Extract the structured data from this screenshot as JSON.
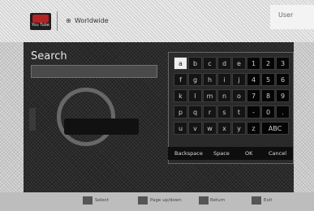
{
  "app": {
    "logo_text": "You Tube",
    "breadcrumb": "Worldwide",
    "breadcrumb_icon": "globe-icon",
    "top_right": "User"
  },
  "search": {
    "title": "Search"
  },
  "keyboard": {
    "rows": [
      [
        "a",
        "b",
        "c",
        "d",
        "e",
        "1",
        "2",
        "3"
      ],
      [
        "f",
        "g",
        "h",
        "i",
        "j",
        "4",
        "5",
        "6"
      ],
      [
        "k",
        "l",
        "m",
        "n",
        "o",
        "7",
        "8",
        "9"
      ],
      [
        "p",
        "q",
        "r",
        "s",
        "t",
        "-",
        "0",
        "."
      ],
      [
        "u",
        "v",
        "w",
        "x",
        "y",
        "z",
        "ABC"
      ]
    ],
    "footer": {
      "backspace": "Backspace",
      "space": "Space",
      "ok": "OK",
      "cancel": "Cancel"
    }
  },
  "hints": [
    {
      "label": "Select"
    },
    {
      "label": "Page up/down"
    },
    {
      "label": "Return"
    },
    {
      "label": "Exit"
    }
  ]
}
